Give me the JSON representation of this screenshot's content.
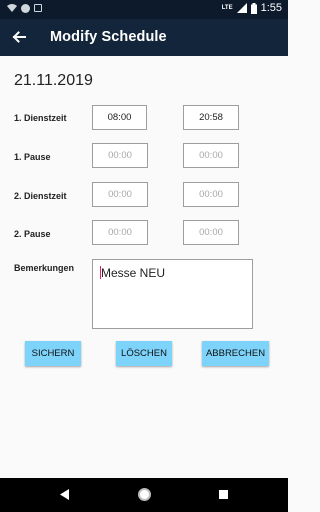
{
  "status_bar": {
    "time": "1:55",
    "network": "LTE"
  },
  "app_bar": {
    "title": "Modify Schedule"
  },
  "date": "21.11.2019",
  "rows": [
    {
      "label": "1. Dienstzeit",
      "start": "08:00",
      "end": "20:58"
    },
    {
      "label": "1. Pause",
      "start": "00:00",
      "end": "00:00"
    },
    {
      "label": "2. Dienstzeit",
      "start": "00:00",
      "end": "00:00"
    },
    {
      "label": "2. Pause",
      "start": "00:00",
      "end": "00:00"
    }
  ],
  "notes": {
    "label": "Bemerkungen",
    "value": "Messe NEU"
  },
  "buttons": {
    "save": "SICHERN",
    "delete": "LÖSCHEN",
    "cancel": "ABBRECHEN"
  },
  "colors": {
    "status_bar": "#0c1a2b",
    "app_bar": "#13253a",
    "button": "#7dd3fa",
    "caret": "#e91e63"
  }
}
